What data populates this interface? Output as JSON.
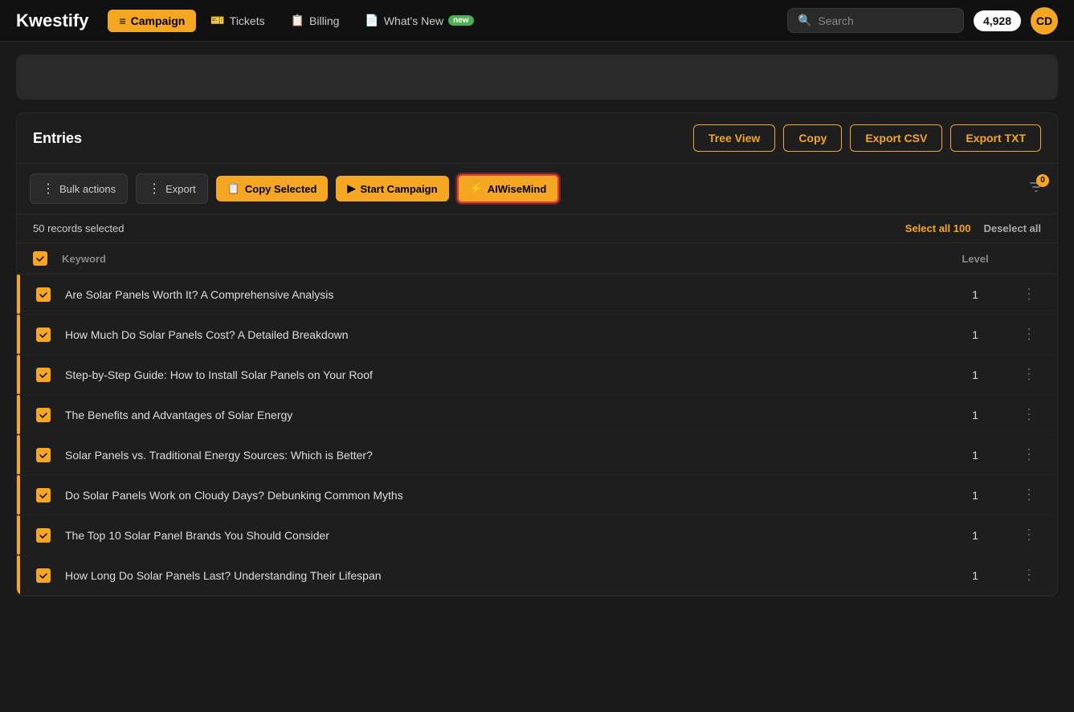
{
  "app": {
    "logo": "Kwestify"
  },
  "navbar": {
    "items": [
      {
        "id": "campaign",
        "label": "Campaign",
        "active": true,
        "icon": "list-icon"
      },
      {
        "id": "tickets",
        "label": "Tickets",
        "active": false,
        "icon": "ticket-icon"
      },
      {
        "id": "billing",
        "label": "Billing",
        "active": false,
        "icon": "billing-icon"
      },
      {
        "id": "whats-new",
        "label": "What's New",
        "active": false,
        "badge": "new",
        "icon": "doc-icon"
      }
    ],
    "search_placeholder": "Search",
    "credits": "4,928",
    "avatar": "CD"
  },
  "entries": {
    "title": "Entries",
    "header_buttons": [
      {
        "id": "tree-view",
        "label": "Tree View"
      },
      {
        "id": "copy",
        "label": "Copy"
      },
      {
        "id": "export-csv",
        "label": "Export CSV"
      },
      {
        "id": "export-txt",
        "label": "Export TXT"
      }
    ],
    "toolbar": {
      "bulk_actions": "Bulk actions",
      "export": "Export",
      "copy_selected": "Copy Selected",
      "start_campaign": "Start Campaign",
      "aiwisemind": "AIWiseMind",
      "filter_count": "0"
    },
    "selection": {
      "count_text": "50 records selected",
      "select_all": "Select all 100",
      "deselect_all": "Deselect all"
    },
    "table": {
      "col_keyword": "Keyword",
      "col_level": "Level",
      "rows": [
        {
          "keyword": "Are Solar Panels Worth It? A Comprehensive Analysis",
          "level": 1,
          "checked": true
        },
        {
          "keyword": "How Much Do Solar Panels Cost? A Detailed Breakdown",
          "level": 1,
          "checked": true
        },
        {
          "keyword": "Step-by-Step Guide: How to Install Solar Panels on Your Roof",
          "level": 1,
          "checked": true
        },
        {
          "keyword": "The Benefits and Advantages of Solar Energy",
          "level": 1,
          "checked": true
        },
        {
          "keyword": "Solar Panels vs. Traditional Energy Sources: Which is Better?",
          "level": 1,
          "checked": true
        },
        {
          "keyword": "Do Solar Panels Work on Cloudy Days? Debunking Common Myths",
          "level": 1,
          "checked": true
        },
        {
          "keyword": "The Top 10 Solar Panel Brands You Should Consider",
          "level": 1,
          "checked": true
        },
        {
          "keyword": "How Long Do Solar Panels Last? Understanding Their Lifespan",
          "level": 1,
          "checked": true
        }
      ]
    }
  }
}
